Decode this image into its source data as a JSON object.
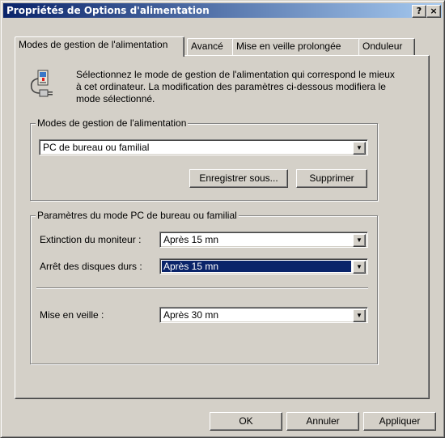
{
  "window": {
    "title": "Propriétés de Options d'alimentation",
    "help_label": "?",
    "close_label": "×"
  },
  "tabs": [
    {
      "label": "Modes de gestion de l'alimentation",
      "active": true
    },
    {
      "label": "Avancé"
    },
    {
      "label": "Mise en veille prolongée"
    },
    {
      "label": "Onduleur"
    }
  ],
  "description": "Sélectionnez le mode de gestion de l'alimentation qui correspond le mieux à cet ordinateur. La modification des paramètres ci-dessous modifiera le mode sélectionné.",
  "schemes_group": {
    "title": "Modes de gestion de l'alimentation",
    "selected": "PC de bureau ou familial",
    "save_as_label": "Enregistrer sous...",
    "delete_label": "Supprimer"
  },
  "settings_group": {
    "title": "Paramètres du mode PC de bureau ou familial",
    "monitor_label": "Extinction du moniteur :",
    "monitor_value": "Après 15 mn",
    "disks_label": "Arrêt des disques durs :",
    "disks_value": "Après 15 mn",
    "standby_label": "Mise en veille :",
    "standby_value": "Après 30 mn"
  },
  "footer": {
    "ok_label": "OK",
    "cancel_label": "Annuler",
    "apply_label": "Appliquer"
  }
}
